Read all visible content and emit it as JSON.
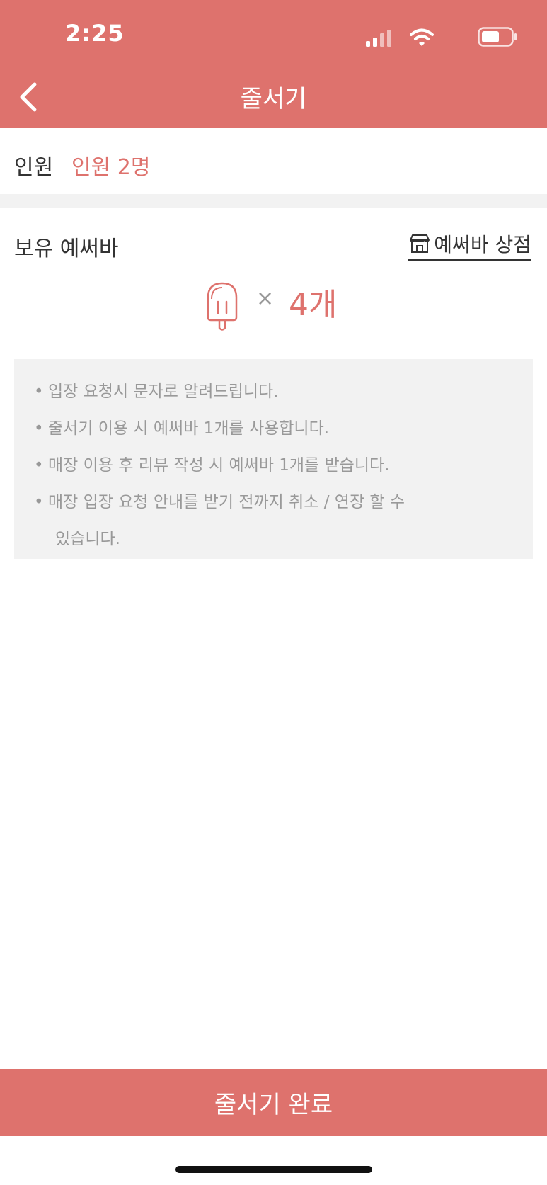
{
  "status": {
    "time": "2:25"
  },
  "header": {
    "title": "줄서기"
  },
  "people": {
    "label": "인원",
    "value": "인원 2명"
  },
  "owned": {
    "label": "보유 예써바",
    "shop_link": "예써바 상점",
    "times": "×",
    "count": "4개"
  },
  "notice": {
    "bullet": "•",
    "lines": [
      "입장 요청시 문자로 알려드립니다.",
      "줄서기 이용 시 예써바 1개를 사용합니다.",
      "매장 이용 후 리뷰 작성 시 예써바 1개를 받습니다.",
      "매장 입장 요청 안내를 받기 전까지 취소 / 연장 할 수",
      "있습니다."
    ]
  },
  "footer": {
    "complete_label": "줄서기 완료"
  },
  "colors": {
    "accent": "#de726d",
    "gray_bg": "#f2f2f2",
    "muted_text": "#999999"
  },
  "icons": {
    "back": "chevron-left-icon",
    "shop": "store-icon",
    "item": "popsicle-icon",
    "signal": "signal-icon",
    "wifi": "wifi-icon",
    "battery": "battery-icon"
  }
}
